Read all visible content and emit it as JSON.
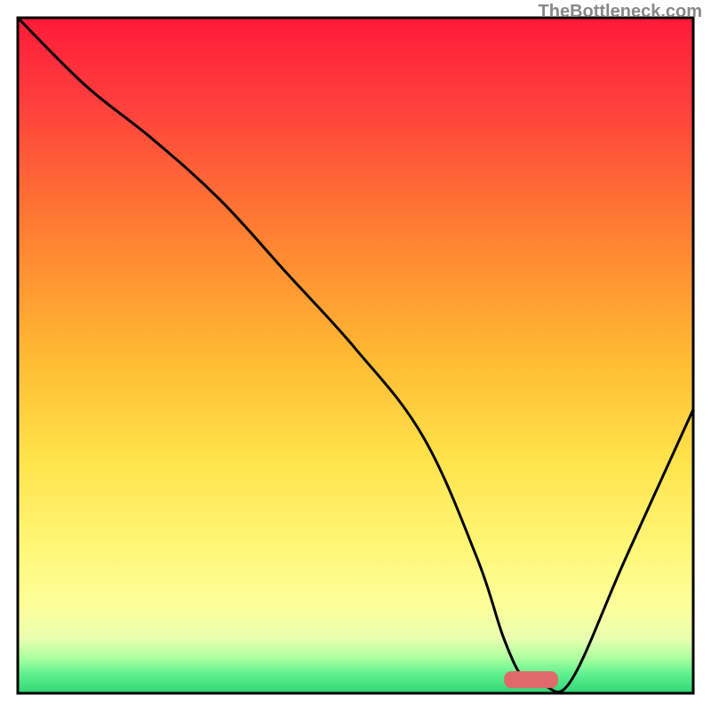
{
  "watermark": "TheBottleneck.com",
  "chart_data": {
    "type": "line",
    "title": "",
    "xlabel": "",
    "ylabel": "",
    "xlim": [
      0,
      100
    ],
    "ylim": [
      0,
      100
    ],
    "background": {
      "type": "vertical-gradient",
      "stops": [
        {
          "offset": 0,
          "color": "#ff1a3a"
        },
        {
          "offset": 12,
          "color": "#ff3d3d"
        },
        {
          "offset": 30,
          "color": "#ff7a33"
        },
        {
          "offset": 50,
          "color": "#ffb933"
        },
        {
          "offset": 65,
          "color": "#ffe24a"
        },
        {
          "offset": 78,
          "color": "#fff676"
        },
        {
          "offset": 87,
          "color": "#fdff9a"
        },
        {
          "offset": 92,
          "color": "#e8ffb0"
        },
        {
          "offset": 95,
          "color": "#a6ff9e"
        },
        {
          "offset": 97,
          "color": "#62f290"
        },
        {
          "offset": 100,
          "color": "#2fd676"
        }
      ]
    },
    "series": [
      {
        "name": "curve",
        "color": "#000000",
        "stroke_width": 3,
        "x": [
          0,
          10,
          20,
          30,
          40,
          50,
          60,
          68,
          72,
          75,
          78,
          82,
          90,
          100
        ],
        "y": [
          100,
          90,
          82,
          73,
          62,
          51,
          38,
          20,
          8,
          2,
          1,
          2,
          20,
          42
        ]
      }
    ],
    "marker": {
      "name": "optimum-marker",
      "shape": "rounded-bar",
      "x": 76,
      "y": 2,
      "width": 8,
      "height": 2.5,
      "color": "#e06a6a"
    },
    "frame": {
      "color": "#000000",
      "width": 3
    }
  }
}
